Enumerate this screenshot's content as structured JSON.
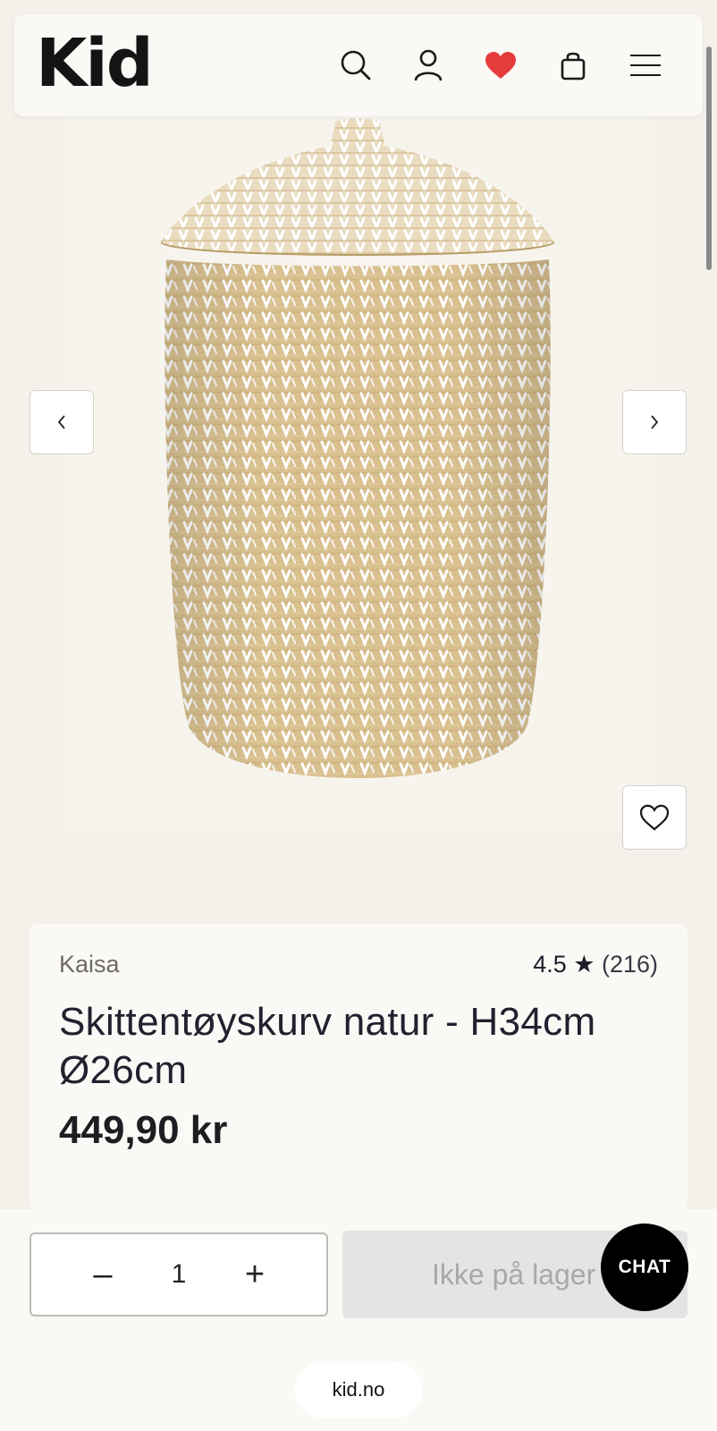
{
  "header": {
    "logo": "Kid",
    "icons": [
      "search-icon",
      "user-icon",
      "heart-icon",
      "bag-icon",
      "menu-icon"
    ],
    "heart_color": "#e63b3b"
  },
  "product": {
    "brand": "Kaisa",
    "rating": "4.5 ★",
    "review_count": "(216)",
    "title": "Skittentøyskurv natur - H34cm Ø26cm",
    "price": "449,90 kr"
  },
  "purchase": {
    "minus": "–",
    "quantity": "1",
    "plus": "+",
    "stock_label": "Ikke på lager",
    "chat_label": "CHAT"
  },
  "browser": {
    "url": "kid.no"
  }
}
